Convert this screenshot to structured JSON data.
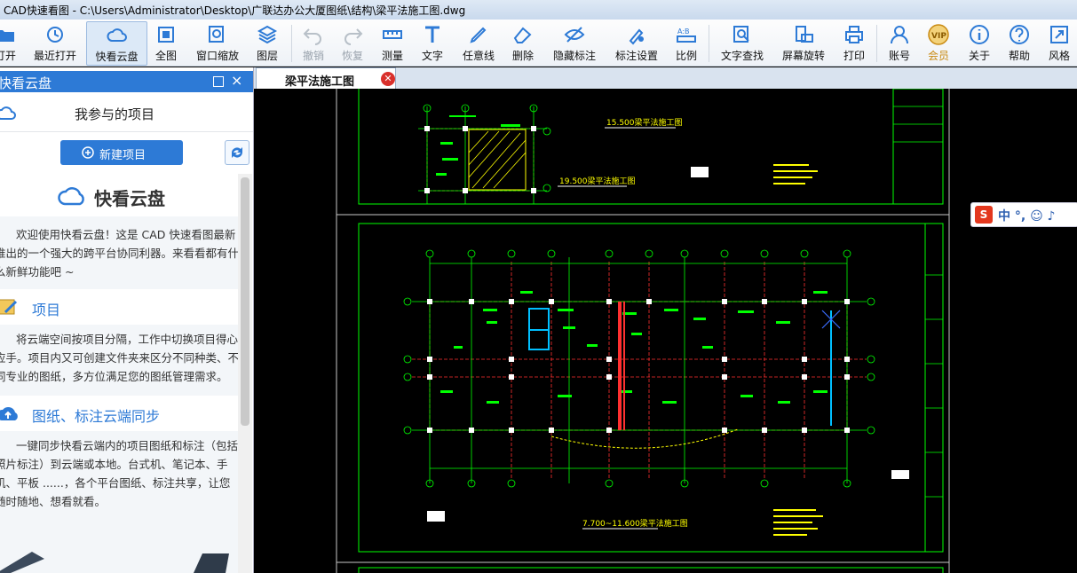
{
  "window": {
    "title": "CAD快速看图 - C:\\Users\\Administrator\\Desktop\\广联达办公大厦图纸\\结构\\梁平法施工图.dwg"
  },
  "toolbar": {
    "open": "打开",
    "recent": "最近打开",
    "cloud": "快看云盘",
    "fit": "全图",
    "window_zoom": "窗口缩放",
    "layers": "图层",
    "undo": "撤销",
    "redo": "恢复",
    "measure": "测量",
    "text": "文字",
    "freeline": "任意线",
    "delete": "删除",
    "hide_markup": "隐藏标注",
    "markup_settings": "标注设置",
    "scale": "比例",
    "text_search": "文字查找",
    "rotate_screen": "屏幕旋转",
    "print": "打印",
    "account": "账号",
    "vip": "会员",
    "about": "关于",
    "help": "帮助",
    "style": "风格",
    "vip_badge": "VIP"
  },
  "panel": {
    "title": "快看云盘",
    "my_projects": "我参与的项目",
    "new_project": "新建项目",
    "brand": "快看云盘",
    "intro_text": "欢迎使用快看云盘！这是 CAD 快速看图最新推出的一个强大的跨平台协同利器。来看看都有什么新鲜功能吧 ~",
    "sec1_title": "项目",
    "sec1_text": "将云端空间按项目分隔，工作中切换项目得心应手。项目内又可创建文件夹来区分不同种类、不同专业的图纸，多方位满足您的图纸管理需求。",
    "sec2_title": "图纸、标注云端同步",
    "sec2_text": "一键同步快看云端内的项目图纸和标注（包括照片标注）到云端或本地。台式机、笔记本、手机、平板 ......，各个平台图纸、标注共享，让您随时随地、想看就看。"
  },
  "document_tab": {
    "label": "梁平法施工图",
    "close": "✕"
  },
  "drawing": {
    "label_upper_1": "15.500梁平法施工图",
    "label_upper_2": "19.500梁平法施工图",
    "label_lower": "7.700~11.600梁平法施工图"
  },
  "ime": {
    "logo": "S",
    "text": "中 °, ☺ ♪"
  },
  "colors": {
    "accent": "#2d7ad6",
    "canvas": "#000000",
    "grid_green": "#00ff00",
    "axis_red": "#ff3030"
  }
}
